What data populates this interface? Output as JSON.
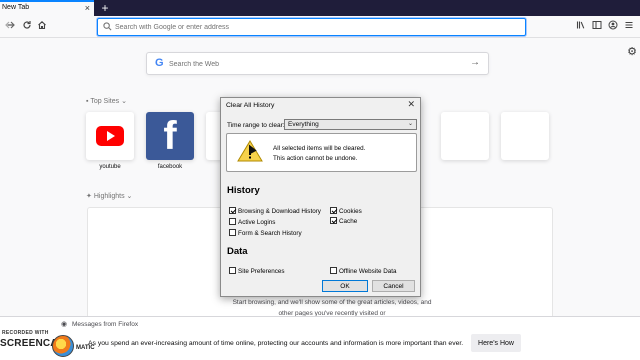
{
  "tabs": [
    {
      "title": "New Tab"
    }
  ],
  "newtab_symbol": "+",
  "toolbar": {
    "back_icon": "arrow-left-icon",
    "forward_icon": "arrow-right-icon",
    "reload_icon": "reload-icon",
    "home_icon": "home-icon",
    "url_placeholder": "Search with Google or enter address",
    "library_icon": "library-icon",
    "sidebar_icon": "sidebar-icon",
    "account_icon": "account-icon",
    "menu_icon": "hamburger-menu-icon"
  },
  "newtab": {
    "search_placeholder": "Search the Web",
    "search_logo": "G",
    "topsites_title": "Top Sites",
    "topsites": [
      {
        "label": "youtube"
      },
      {
        "label": "facebook"
      }
    ],
    "highlights_title": "Highlights",
    "highlights_empty_text": "Start browsing, and we'll show some of the great articles, videos, and other pages you've recently visited or"
  },
  "dialog": {
    "title": "Clear All History",
    "time_range_label": "Time range to clear:",
    "time_range_value": "Everything",
    "warning_line1": "All selected items will be cleared.",
    "warning_line2": "This action cannot be undone.",
    "history_heading": "History",
    "history_items": [
      {
        "label": "Browsing & Download History",
        "checked": true
      },
      {
        "label": "Cookies",
        "checked": true
      },
      {
        "label": "Active Logins",
        "checked": false
      },
      {
        "label": "Cache",
        "checked": true
      },
      {
        "label": "Form & Search History",
        "checked": false
      }
    ],
    "data_heading": "Data",
    "data_items": [
      {
        "label": "Site Preferences",
        "checked": false
      },
      {
        "label": "Offline Website Data",
        "checked": false
      }
    ],
    "ok_label": "OK",
    "cancel_label": "Cancel"
  },
  "message_bar": {
    "title": "Messages from Firefox",
    "body": "As you spend an ever-increasing amount of time online, protecting our accounts and information is more important than ever.",
    "button_label": "Here's How"
  },
  "watermark": {
    "line1": "RECORDED WITH",
    "line2": "SCREENCAST",
    "line3": "MATIC"
  }
}
